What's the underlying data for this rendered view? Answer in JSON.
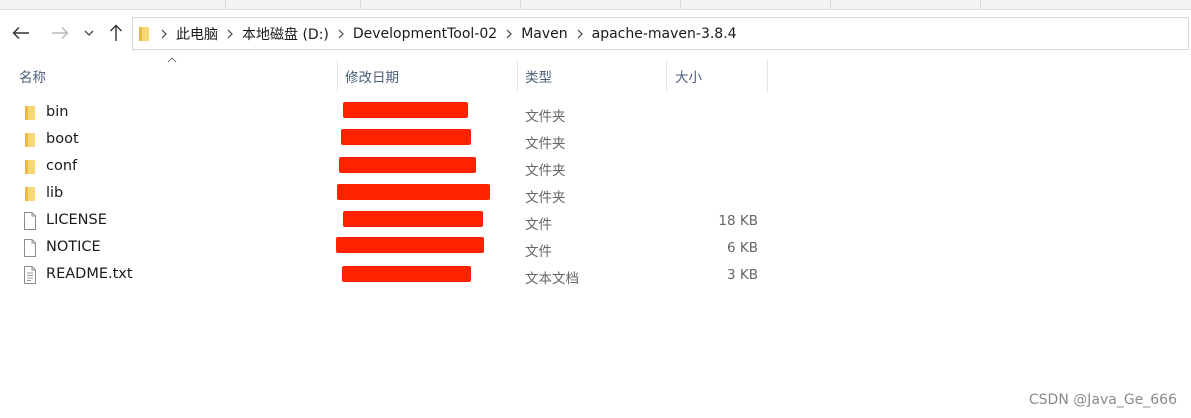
{
  "toolbar": {
    "back_icon": "arrow-left-icon",
    "forward_icon": "arrow-right-icon",
    "recent_icon": "chevron-down-icon",
    "up_icon": "arrow-up-icon"
  },
  "address": {
    "breadcrumbs": [
      "此电脑",
      "本地磁盘 (D:)",
      "DevelopmentTool-02",
      "Maven",
      "apache-maven-3.8.4"
    ]
  },
  "columns": {
    "name": "名称",
    "modified": "修改日期",
    "type": "类型",
    "size": "大小"
  },
  "files": [
    {
      "name": "bin",
      "kind": "folder",
      "type": "文件夹",
      "size": ""
    },
    {
      "name": "boot",
      "kind": "folder",
      "type": "文件夹",
      "size": ""
    },
    {
      "name": "conf",
      "kind": "folder",
      "type": "文件夹",
      "size": ""
    },
    {
      "name": "lib",
      "kind": "folder",
      "type": "文件夹",
      "size": ""
    },
    {
      "name": "LICENSE",
      "kind": "file",
      "type": "文件",
      "size": "18 KB"
    },
    {
      "name": "NOTICE",
      "kind": "file",
      "type": "文件",
      "size": "6 KB"
    },
    {
      "name": "README.txt",
      "kind": "file",
      "type": "文本文档",
      "size": "3 KB"
    }
  ],
  "colors": {
    "folder": "#f8d775",
    "redaction": "#ff2200",
    "header_text": "#4c607a"
  },
  "watermark": "CSDN @Java_Ge_666"
}
